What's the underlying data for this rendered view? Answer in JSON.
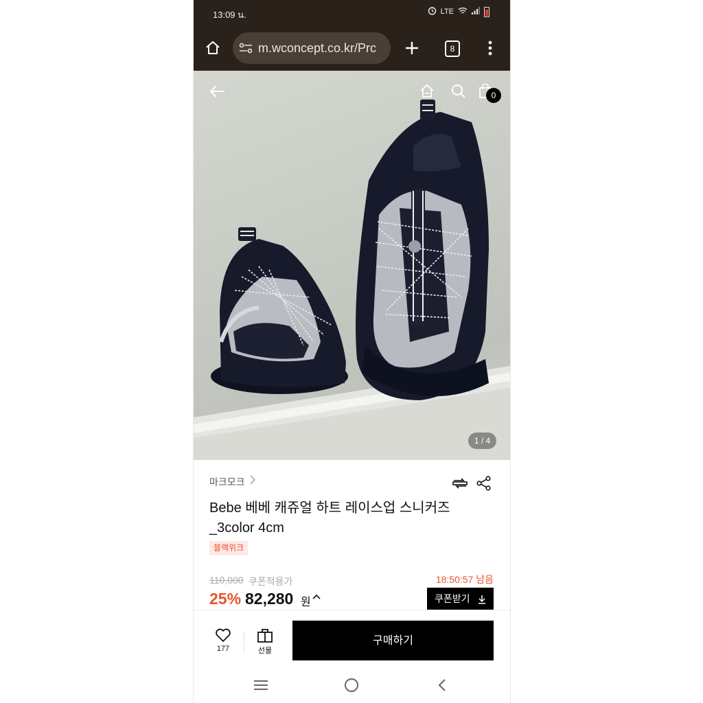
{
  "status_bar": {
    "time": "13:09 น.",
    "network": "LTE"
  },
  "browser": {
    "url": "m.wconcept.co.kr/Prc",
    "tab_count": "8"
  },
  "product_view": {
    "image_counter": "1 / 4",
    "cart_count": "0"
  },
  "product": {
    "brand": "마크모크",
    "title_line1": "Bebe 베베 캐쥬얼 하트 레이스업 스니커즈",
    "title_line2": "_3color 4cm",
    "tag": "블랙위크"
  },
  "pricing": {
    "original_price": "110,000",
    "coupon_label": "쿠폰적용가",
    "timer": "18:50:57 남음",
    "discount": "25%",
    "price": "82,280",
    "currency": "원",
    "coupon_button": "쿠폰받기"
  },
  "actions": {
    "like_count": "177",
    "gift_label": "선물",
    "buy_label": "구매하기"
  },
  "colors": {
    "accent": "#e8542e",
    "browser_bar": "#2a211b",
    "primary_button": "#000000"
  },
  "icons": [
    "home-icon",
    "site-settings-icon",
    "plus-icon",
    "tab-switcher-icon",
    "more-icon",
    "back-arrow-icon",
    "home-outline-icon",
    "search-icon",
    "shopping-bag-icon",
    "chevron-right-icon",
    "compare-icon",
    "share-icon",
    "chevron-up-icon",
    "download-icon",
    "heart-icon",
    "gift-icon",
    "recent-apps-icon",
    "home-circle-icon",
    "back-chevron-icon"
  ]
}
